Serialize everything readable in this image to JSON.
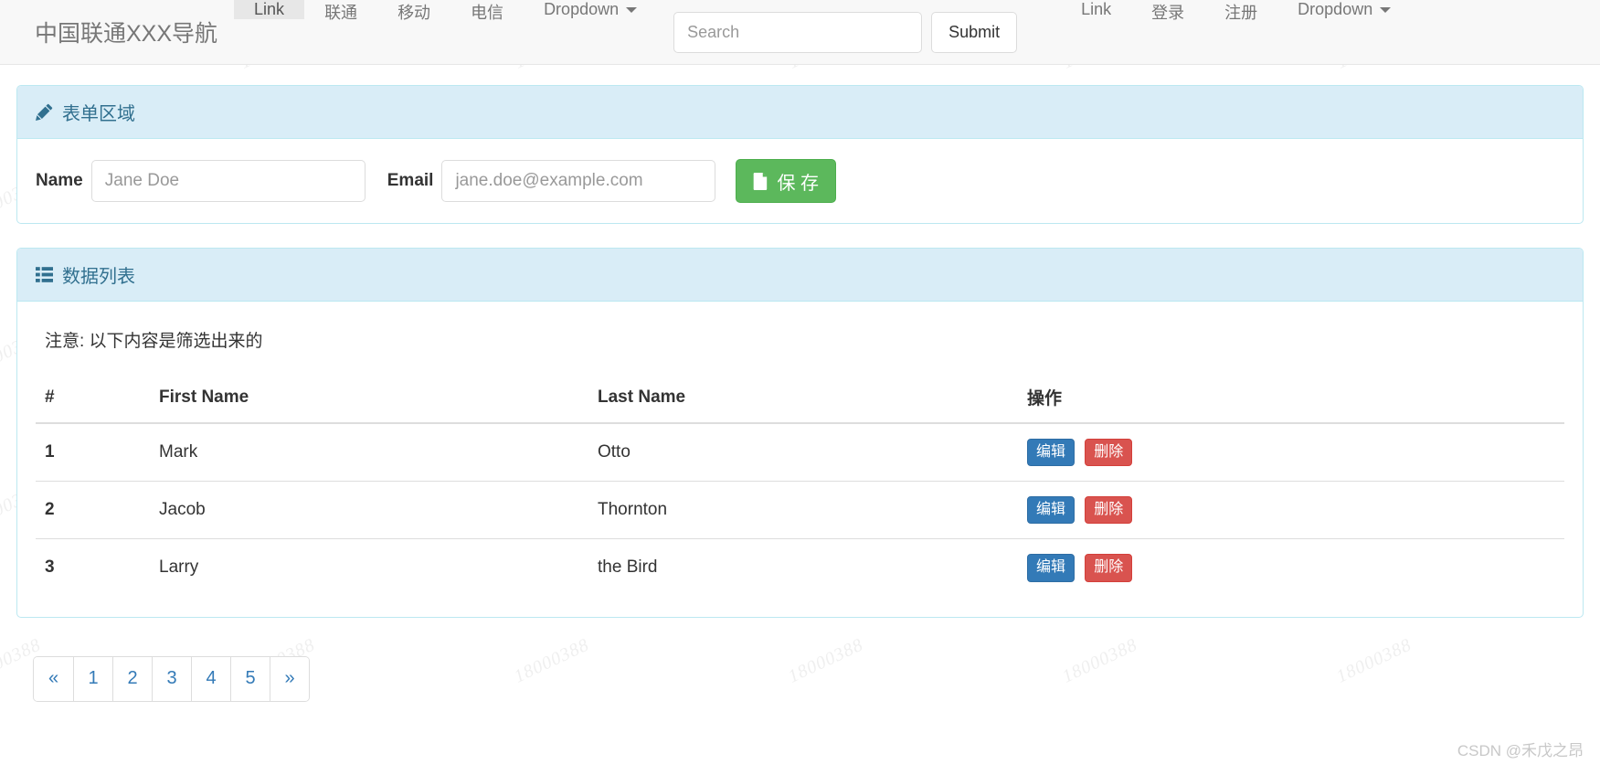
{
  "navbar": {
    "brand": "中国联通XXX导航",
    "left_items": [
      {
        "label": "Link",
        "active": true,
        "caret": false
      },
      {
        "label": "联通",
        "active": false,
        "caret": false
      },
      {
        "label": "移动",
        "active": false,
        "caret": false
      },
      {
        "label": "电信",
        "active": false,
        "caret": false
      },
      {
        "label": "Dropdown",
        "active": false,
        "caret": true
      }
    ],
    "search": {
      "value": "",
      "placeholder": "Search",
      "submit_label": "Submit"
    },
    "right_items": [
      {
        "label": "Link",
        "active": false,
        "caret": false
      },
      {
        "label": "登录",
        "active": false,
        "caret": false
      },
      {
        "label": "注册",
        "active": false,
        "caret": false
      },
      {
        "label": "Dropdown",
        "active": false,
        "caret": true
      }
    ]
  },
  "form_panel": {
    "title": "表单区域",
    "icon": "pencil-icon",
    "name_label": "Name",
    "name_value": "",
    "name_placeholder": "Jane Doe",
    "email_label": "Email",
    "email_value": "",
    "email_placeholder": "jane.doe@example.com",
    "save_label": "保 存",
    "save_icon": "file-icon"
  },
  "list_panel": {
    "title": "数据列表",
    "icon": "th-list-icon",
    "note": "注意: 以下内容是筛选出来的",
    "columns": [
      "#",
      "First Name",
      "Last Name",
      "操作"
    ],
    "rows": [
      {
        "index": "1",
        "first_name": "Mark",
        "last_name": "Otto",
        "edit": "编辑",
        "delete": "删除"
      },
      {
        "index": "2",
        "first_name": "Jacob",
        "last_name": "Thornton",
        "edit": "编辑",
        "delete": "删除"
      },
      {
        "index": "3",
        "first_name": "Larry",
        "last_name": "the Bird",
        "edit": "编辑",
        "delete": "删除"
      }
    ]
  },
  "pagination": {
    "items": [
      "«",
      "1",
      "2",
      "3",
      "4",
      "5",
      "»"
    ]
  },
  "watermarks": {
    "tile_text": "18000388",
    "footer": "CSDN @禾戊之昂"
  },
  "colors": {
    "navbar_bg": "#f8f8f8",
    "panel_heading_bg": "#d9edf7",
    "panel_border": "#bce8f1",
    "panel_heading_text": "#31708f",
    "save_green": "#5cb85c",
    "edit_blue": "#337ab7",
    "delete_red": "#d9534f",
    "link_blue": "#337ab7"
  }
}
